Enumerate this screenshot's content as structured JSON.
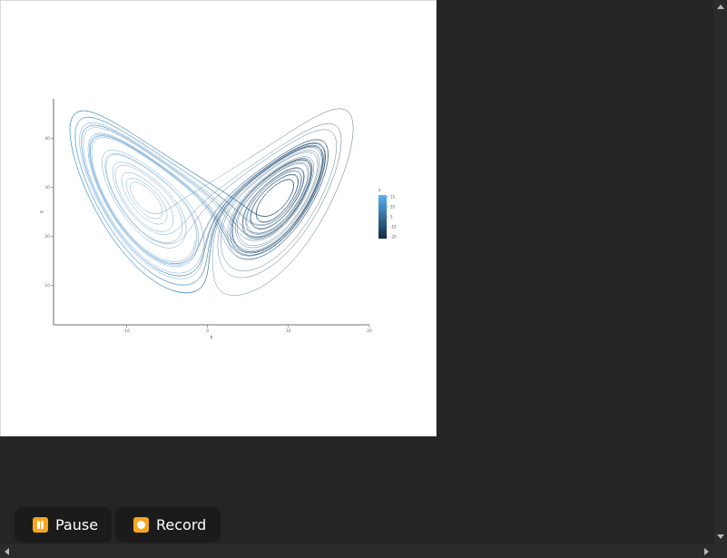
{
  "controls": {
    "pause_label": "Pause",
    "pause_icon": "pause-icon",
    "record_label": "Record",
    "record_icon": "record-icon",
    "accent_color": "#f5a623"
  },
  "chart_data": {
    "type": "line",
    "title": "",
    "xlabel": "x",
    "ylabel": "y",
    "x_ticks": [
      "-10",
      "0",
      "10",
      "20"
    ],
    "y_ticks": [
      "10",
      "20",
      "30",
      "40"
    ],
    "xlim": [
      -19,
      20
    ],
    "ylim": [
      2,
      48
    ],
    "grid": false,
    "legend": {
      "title": "z",
      "placement": "right",
      "labels": [
        "15",
        "10",
        "5",
        "-10",
        "-20"
      ],
      "colors": [
        "#56b1f7",
        "#132b43"
      ]
    },
    "series": [
      {
        "values": "Lorenz attractor trajectory (dense curve, colored by z)"
      }
    ]
  }
}
